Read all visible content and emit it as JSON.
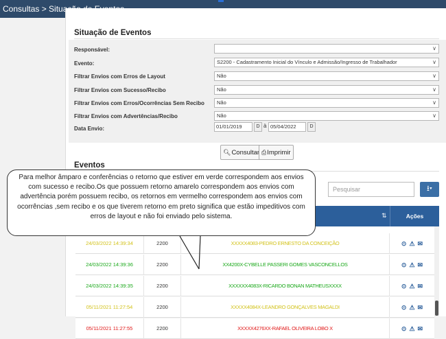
{
  "header": {
    "breadcrumb": "Consultas > Situação de Eventos"
  },
  "filters": {
    "section_title": "Situação de Eventos",
    "responsavel_label": "Responsável:",
    "responsavel_value": "",
    "evento_label": "Evento:",
    "evento_value": "S2200 - Cadastramento Inicial do Vínculo e Admissão/Ingresso de Trabalhador",
    "erros_layout_label": "Filtrar Envios com Erros de Layout",
    "erros_layout_value": "Não",
    "sucesso_label": "Filtrar Envios com Sucesso/Recibo",
    "sucesso_value": "Não",
    "ocorrencias_label": "Filtrar Envios com Erros/Ocorrências Sem Recibo",
    "ocorrencias_value": "Não",
    "advertencias_label": "Filtrar Envios com Advertências/Recibo",
    "advertencias_value": "Não",
    "data_label": "Data Envio:",
    "date_from": "01/01/2019",
    "date_to": "05/04/2022",
    "date_btn": "D",
    "date_sep": "à"
  },
  "actions": {
    "consultar": "Consultar",
    "imprimir": "Imprimir"
  },
  "events": {
    "section_title": "Eventos",
    "search_placeholder": "Pesquisar",
    "acoes_header": "Ações",
    "rows": [
      {
        "date": "24/03/2022 14:39:34",
        "code": "2200",
        "desc": "XXXXX4083-PEDRO ERNESTO DA CONCEIÇÃO",
        "color": "#d2c21a"
      },
      {
        "date": "24/03/2022 14:39:36",
        "code": "2200",
        "desc": "XX4200X-CYBELLE PASSERI GOMES VASCONCELLOS",
        "color": "#1aa81a"
      },
      {
        "date": "24/03/2022 14:39:35",
        "code": "2200",
        "desc": "XXXXXX4083X-RICARDO BONAN MATHEUSXXXX",
        "color": "#1aa81a"
      },
      {
        "date": "05/11/2021 11:27:54",
        "code": "2200",
        "desc": "XXXXX4084X-LEANDRO GONÇALVES MAGALDI",
        "color": "#d2c21a"
      },
      {
        "date": "05/11/2021 11:27:55",
        "code": "2200",
        "desc": "XXXXX4276XX-RAFAEL OLIVEIRA LOBO X",
        "color": "#e01818"
      }
    ]
  },
  "callout": {
    "text": "Para melhor âmparo e conferências o retorno que estiver em verde correspondem aos envios com sucesso e recibo.Os que possuem retorno amarelo correspondem aos envios com advertência porém possuem recibo, os retornos em vermelho correspondem aos envios com ocorrências ,sem recibo e os que tiverem retorno em preto significa que estão impeditivos com erros de layout e não foi enviado pelo sistema."
  }
}
